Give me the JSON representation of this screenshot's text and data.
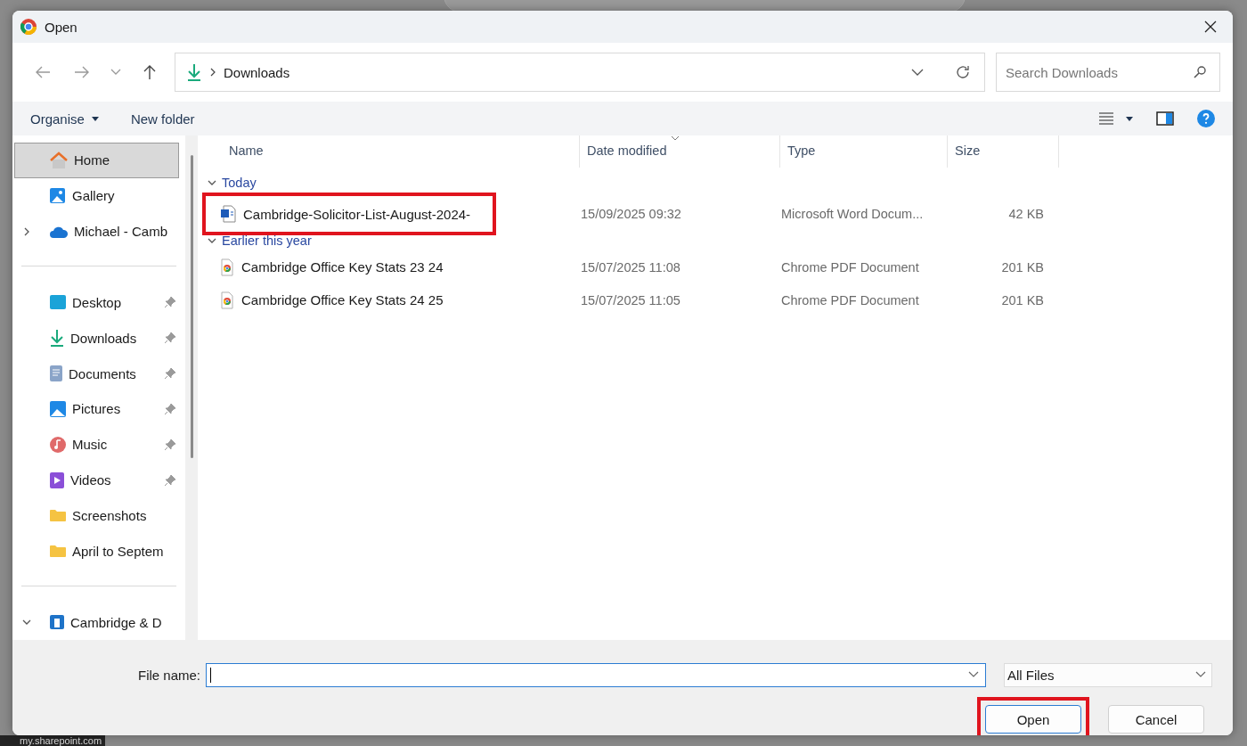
{
  "backdrop": {
    "status_text": "my.sharepoint.com"
  },
  "window": {
    "title": "Open"
  },
  "address": {
    "path": "Downloads",
    "search_placeholder": "Search Downloads"
  },
  "toolbar": {
    "organise": "Organise",
    "new_folder": "New folder"
  },
  "nav": {
    "sections": [
      [
        {
          "label": "Home",
          "kind": "home",
          "selected": true,
          "pinned": false
        },
        {
          "label": "Gallery",
          "kind": "gallery",
          "selected": false,
          "pinned": false
        },
        {
          "label": "Michael - Camb",
          "kind": "cloud",
          "selected": false,
          "pinned": false,
          "expanded": false
        }
      ],
      [
        {
          "label": "Desktop",
          "kind": "desktop",
          "selected": false,
          "pinned": true
        },
        {
          "label": "Downloads",
          "kind": "downloads",
          "selected": false,
          "pinned": true
        },
        {
          "label": "Documents",
          "kind": "documents",
          "selected": false,
          "pinned": true
        },
        {
          "label": "Pictures",
          "kind": "pictures",
          "selected": false,
          "pinned": true
        },
        {
          "label": "Music",
          "kind": "music",
          "selected": false,
          "pinned": true
        },
        {
          "label": "Videos",
          "kind": "videos",
          "selected": false,
          "pinned": true
        },
        {
          "label": "Screenshots",
          "kind": "folder",
          "selected": false,
          "pinned": false
        },
        {
          "label": "April to Septem",
          "kind": "folder",
          "selected": false,
          "pinned": false
        }
      ],
      [
        {
          "label": "Cambridge & D",
          "kind": "building",
          "selected": false,
          "pinned": false,
          "expanded": true
        }
      ]
    ]
  },
  "columns": [
    "Name",
    "Date modified",
    "Type",
    "Size"
  ],
  "groups": [
    {
      "label": "Today",
      "expanded": true,
      "files": [
        {
          "name": "Cambridge-Solicitor-List-August-2024-",
          "kind": "word",
          "date": "15/09/2025 09:32",
          "type": "Microsoft Word Docum...",
          "size": "42 KB",
          "highlighted": true
        }
      ]
    },
    {
      "label": "Earlier this year",
      "expanded": true,
      "files": [
        {
          "name": "Cambridge Office Key Stats 23 24",
          "kind": "pdf",
          "date": "15/07/2025 11:08",
          "type": "Chrome PDF Document",
          "size": "201 KB",
          "highlighted": false
        },
        {
          "name": "Cambridge Office Key Stats 24 25",
          "kind": "pdf",
          "date": "15/07/2025 11:05",
          "type": "Chrome PDF Document",
          "size": "201 KB",
          "highlighted": false
        }
      ]
    }
  ],
  "footer": {
    "file_name_label": "File name:",
    "file_type": "All Files",
    "buttons": [
      {
        "label": "Open",
        "kind": "primary",
        "highlighted": true
      },
      {
        "label": "Cancel",
        "kind": "secondary",
        "highlighted": false
      }
    ]
  }
}
